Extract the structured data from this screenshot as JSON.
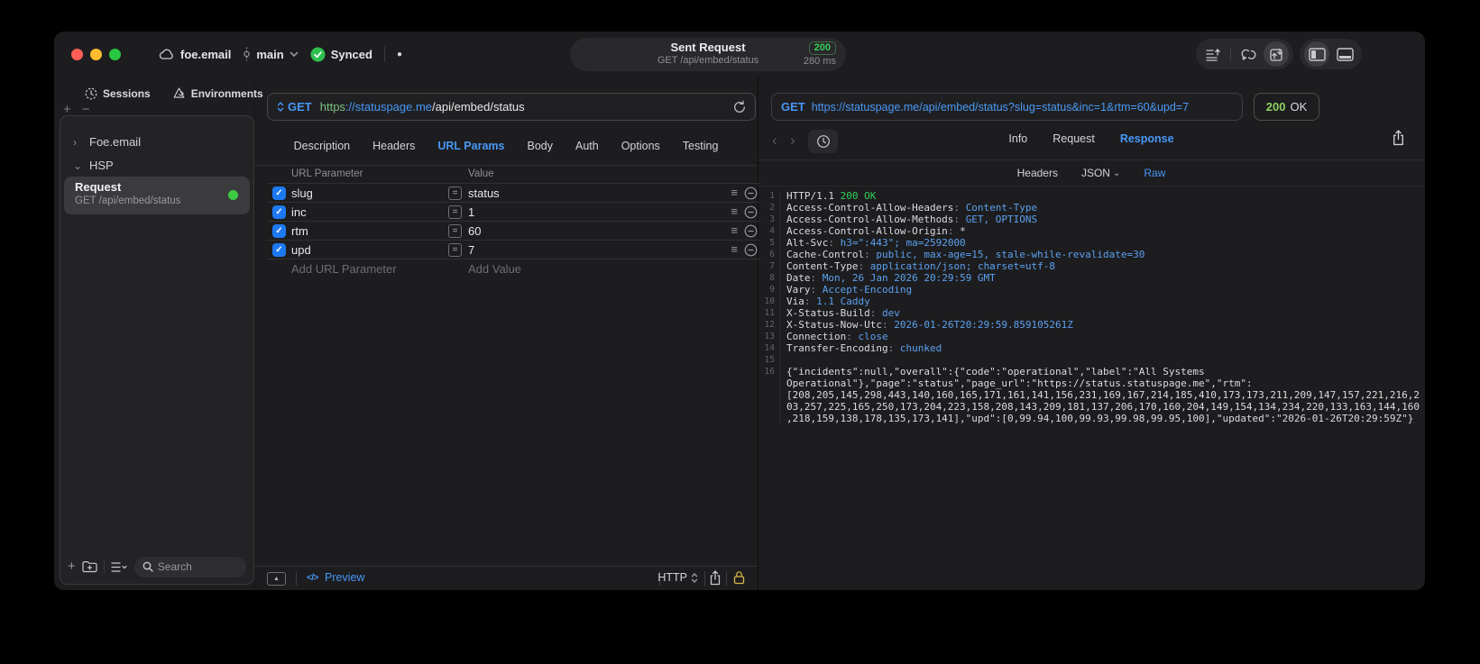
{
  "icons": {
    "plus": "+",
    "minus": "−",
    "chevron_right": "›",
    "chevron_down": "⌄",
    "back": "‹",
    "forward": "›",
    "dot": "●",
    "check": "✓",
    "hamburger": "≡",
    "triangle_up": "▲",
    "equals": "=",
    "code_glyph": "</>"
  },
  "colors": {
    "accent_blue": "#4897f7",
    "method_blue": "#3f8fff",
    "success_green": "#30d158",
    "checkbox_blue": "#1d79f2",
    "https_green": "#7dc383",
    "lock_gold": "#d9b64a"
  },
  "titlebar": {
    "project": "foe.email",
    "branch": "main",
    "sync_label": "Synced",
    "request_title": "Sent Request",
    "request_subtitle": "GET /api/embed/status",
    "status_code": "200",
    "duration": "280 ms"
  },
  "sidebar": {
    "tabs": [
      {
        "label": "Sessions"
      },
      {
        "label": "Environments"
      }
    ],
    "tree": [
      {
        "label": "Foe.email"
      },
      {
        "label": "HSP"
      }
    ],
    "request_item": {
      "title": "Request",
      "subtitle": "GET /api/embed/status"
    },
    "search_placeholder": "Search"
  },
  "request_pane": {
    "method": "GET",
    "url": {
      "scheme": "https",
      "host": "://statuspage.me",
      "path": "/api/embed/status"
    },
    "tabs": [
      "Description",
      "Headers",
      "URL Params",
      "Body",
      "Auth",
      "Options",
      "Testing"
    ],
    "active_tab": "URL Params",
    "table": {
      "col_param": "URL Parameter",
      "col_value": "Value",
      "rows": [
        {
          "name": "slug",
          "value": "status"
        },
        {
          "name": "inc",
          "value": "1"
        },
        {
          "name": "rtm",
          "value": "60"
        },
        {
          "name": "upd",
          "value": "7"
        }
      ],
      "add_param_placeholder": "Add URL Parameter",
      "add_value_placeholder": "Add Value"
    },
    "footer": {
      "preview_label": "Preview",
      "protocol": "HTTP"
    }
  },
  "response_pane": {
    "method": "GET",
    "url": "https://statuspage.me/api/embed/status?slug=status&inc=1&rtm=60&upd=7",
    "status_code": "200",
    "status_text": "OK",
    "tabs": [
      "Info",
      "Request",
      "Response"
    ],
    "active_tab": "Response",
    "subtabs": [
      "Headers",
      "JSON",
      "Raw"
    ],
    "active_subtab": "Raw",
    "code_lines": [
      {
        "n": "1",
        "parts": [
          {
            "t": "HTTP/1.1 ",
            "c": "w"
          },
          {
            "t": "200 OK",
            "c": "g"
          }
        ]
      },
      {
        "n": "2",
        "parts": [
          {
            "t": "Access-Control-Allow-Headers",
            "c": "w"
          },
          {
            "t": ": ",
            "c": "d"
          },
          {
            "t": "Content-Type",
            "c": "b"
          }
        ]
      },
      {
        "n": "3",
        "parts": [
          {
            "t": "Access-Control-Allow-Methods",
            "c": "w"
          },
          {
            "t": ": ",
            "c": "d"
          },
          {
            "t": "GET, OPTIONS",
            "c": "b"
          }
        ]
      },
      {
        "n": "4",
        "parts": [
          {
            "t": "Access-Control-Allow-Origin",
            "c": "w"
          },
          {
            "t": ": ",
            "c": "d"
          },
          {
            "t": "*",
            "c": "w"
          }
        ]
      },
      {
        "n": "5",
        "parts": [
          {
            "t": "Alt-Svc",
            "c": "w"
          },
          {
            "t": ": ",
            "c": "d"
          },
          {
            "t": "h3=\":443\"; ma=2592000",
            "c": "b"
          }
        ]
      },
      {
        "n": "6",
        "parts": [
          {
            "t": "Cache-Control",
            "c": "w"
          },
          {
            "t": ": ",
            "c": "d"
          },
          {
            "t": "public, max-age=15, stale-while-revalidate=30",
            "c": "b"
          }
        ]
      },
      {
        "n": "7",
        "parts": [
          {
            "t": "Content-Type",
            "c": "w"
          },
          {
            "t": ": ",
            "c": "d"
          },
          {
            "t": "application/json; charset=utf-8",
            "c": "b"
          }
        ]
      },
      {
        "n": "8",
        "parts": [
          {
            "t": "Date",
            "c": "w"
          },
          {
            "t": ": ",
            "c": "d"
          },
          {
            "t": "Mon, 26 Jan 2026 20:29:59 GMT",
            "c": "b"
          }
        ]
      },
      {
        "n": "9",
        "parts": [
          {
            "t": "Vary",
            "c": "w"
          },
          {
            "t": ": ",
            "c": "d"
          },
          {
            "t": "Accept-Encoding",
            "c": "b"
          }
        ]
      },
      {
        "n": "10",
        "parts": [
          {
            "t": "Via",
            "c": "w"
          },
          {
            "t": ": ",
            "c": "d"
          },
          {
            "t": "1.1 Caddy",
            "c": "b"
          }
        ]
      },
      {
        "n": "11",
        "parts": [
          {
            "t": "X-Status-Build",
            "c": "w"
          },
          {
            "t": ": ",
            "c": "d"
          },
          {
            "t": "dev",
            "c": "b"
          }
        ]
      },
      {
        "n": "12",
        "parts": [
          {
            "t": "X-Status-Now-Utc",
            "c": "w"
          },
          {
            "t": ": ",
            "c": "d"
          },
          {
            "t": "2026-01-26T20:29:59.859105261Z",
            "c": "b"
          }
        ]
      },
      {
        "n": "13",
        "parts": [
          {
            "t": "Connection",
            "c": "w"
          },
          {
            "t": ": ",
            "c": "d"
          },
          {
            "t": "close",
            "c": "b"
          }
        ]
      },
      {
        "n": "14",
        "parts": [
          {
            "t": "Transfer-Encoding",
            "c": "w"
          },
          {
            "t": ": ",
            "c": "d"
          },
          {
            "t": "chunked",
            "c": "b"
          }
        ]
      },
      {
        "n": "15",
        "parts": []
      },
      {
        "n": "16",
        "wrap": true,
        "parts": [
          {
            "t": "{\"incidents\":null,\"overall\":{\"code\":\"operational\",\"label\":\"All Systems Operational\"},\"page\":\"status\",\"page_url\":\"https://status.statuspage.me\",\"rtm\":[208,205,145,298,443,140,160,165,171,161,141,156,231,169,167,214,185,410,173,173,211,209,147,157,221,216,203,257,225,165,250,173,204,223,158,208,143,209,181,137,206,170,160,204,149,154,134,234,220,133,163,144,160,218,159,138,178,135,173,141],\"upd\":[0,99.94,100,99.93,99.98,99.95,100],\"updated\":\"2026-01-26T20:29:59Z\"}",
            "c": "w"
          }
        ]
      }
    ]
  }
}
